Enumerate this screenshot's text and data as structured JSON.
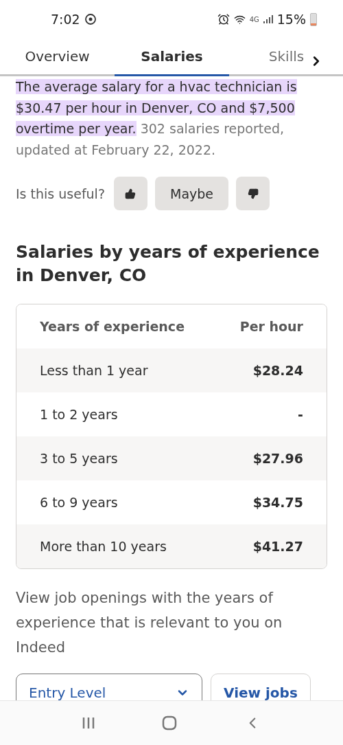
{
  "status_bar": {
    "time": "7:02",
    "network": "4G",
    "battery": "15%"
  },
  "tabs": [
    {
      "label": "Overview",
      "selected": false
    },
    {
      "label": "Salaries",
      "selected": true
    },
    {
      "label": "Skills",
      "selected": false
    }
  ],
  "summary": {
    "highlighted": "The average salary for a hvac technician is $30.47 per hour in Denver, CO and $7,500 overtime per year.",
    "rest": "302 salaries reported, updated at February 22, 2022."
  },
  "feedback": {
    "question": "Is this useful?",
    "maybe": "Maybe"
  },
  "section_title": "Salaries by years of experience in Denver, CO",
  "table": {
    "columns": [
      "Years of experience",
      "Per hour"
    ],
    "rows": [
      {
        "years": "Less than 1 year",
        "pay": "$28.24"
      },
      {
        "years": "1 to 2 years",
        "pay": "-"
      },
      {
        "years": "3 to 5 years",
        "pay": "$27.96"
      },
      {
        "years": "6 to 9 years",
        "pay": "$34.75"
      },
      {
        "years": "More than 10 years",
        "pay": "$41.27"
      }
    ]
  },
  "jobs_prompt": "View job openings with the years of experience that is relevant to you on Indeed",
  "level_select": {
    "value": "Entry Level"
  },
  "view_jobs": "View jobs"
}
